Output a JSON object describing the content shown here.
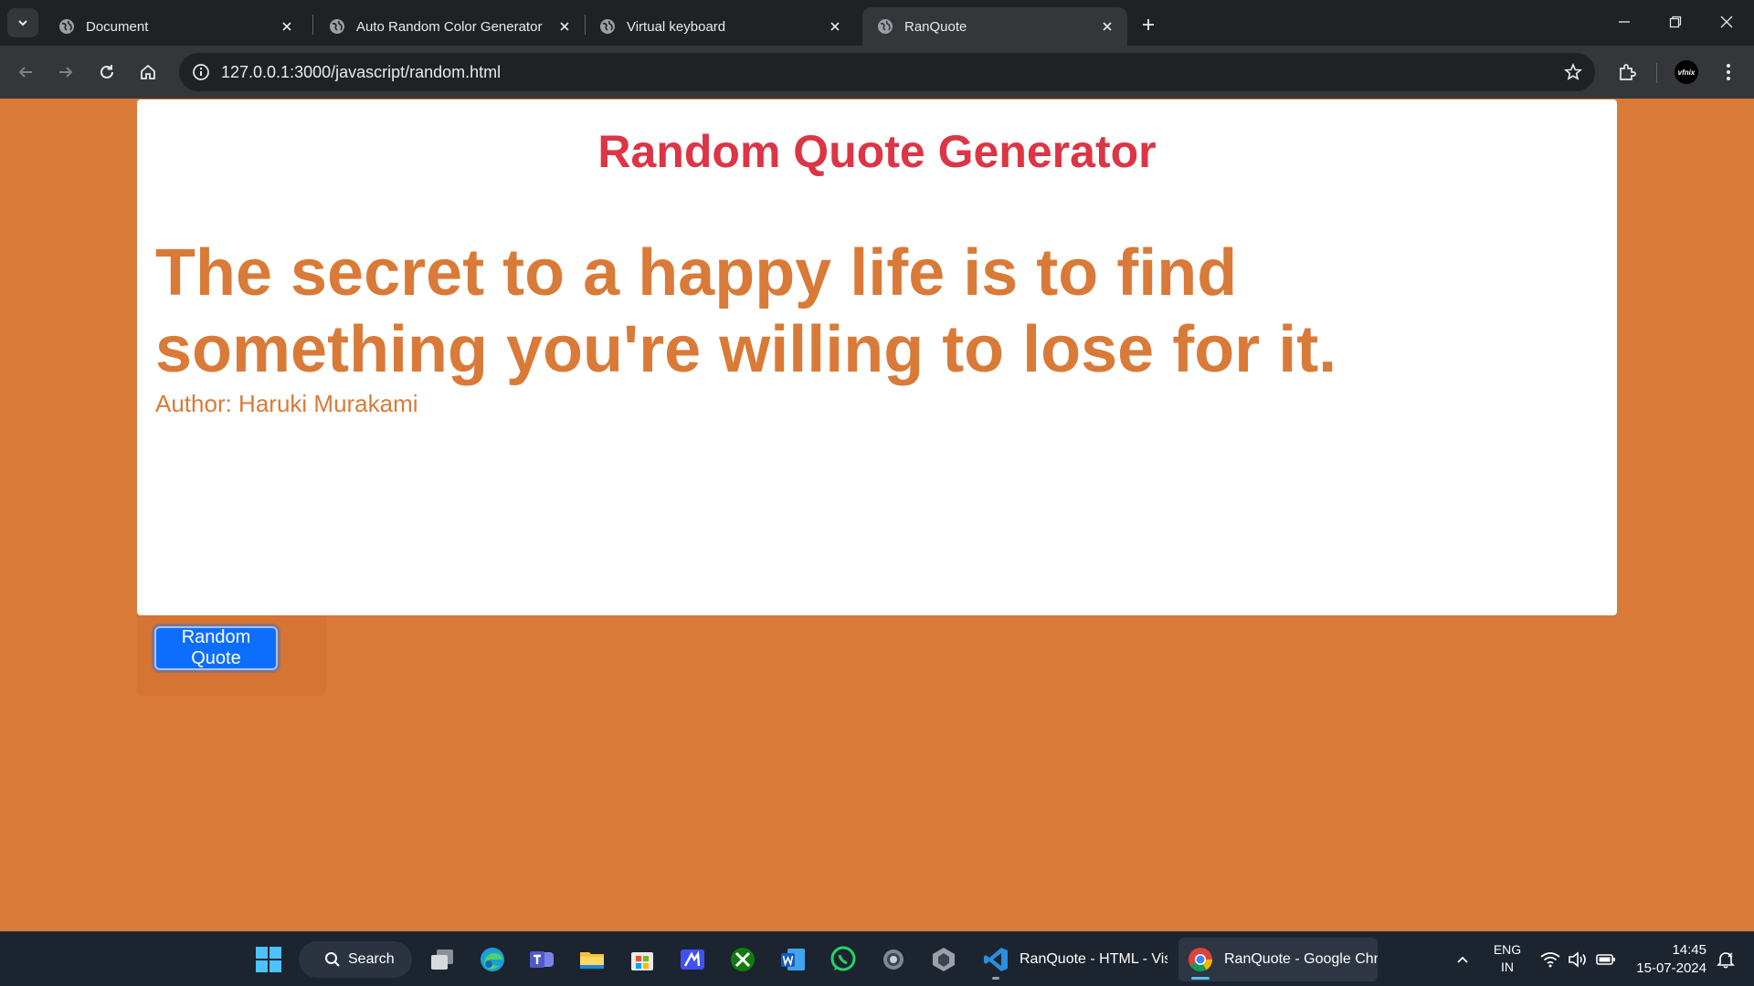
{
  "browser": {
    "tabs": [
      {
        "title": "Document",
        "active": false
      },
      {
        "title": "Auto Random Color Generator",
        "active": false
      },
      {
        "title": "Virtual keyboard",
        "active": false
      },
      {
        "title": "RanQuote",
        "active": true
      }
    ],
    "url": "127.0.0.1:3000/javascript/random.html",
    "profile_label": "vfnix"
  },
  "page": {
    "title": "Random Quote Generator",
    "quote": "The secret to a happy life is to find something you're willing to lose for it.",
    "author": "Author: Haruki Murakami",
    "button_label": "Random Quote"
  },
  "taskbar": {
    "search_label": "Search",
    "pinned_icons": [
      "task-view-icon",
      "edge-icon",
      "teams-icon",
      "file-explorer-icon",
      "store-icon",
      "pen-app-icon",
      "xbox-icon",
      "word-icon",
      "whatsapp-icon",
      "settings-icon",
      "unity-icon"
    ],
    "running_apps": [
      {
        "label": "RanQuote - HTML - Visual Studio Code",
        "icon": "vscode-icon",
        "active": false
      },
      {
        "label": "RanQuote - Google Chrome",
        "icon": "chrome-icon",
        "active": true
      }
    ],
    "language": {
      "line1": "ENG",
      "line2": "IN"
    },
    "time": "14:45",
    "date": "15-07-2024"
  },
  "colors": {
    "page_background": "#d97a38",
    "title_color": "#dc3545",
    "quote_color": "#d97a38",
    "button_color": "#0d6efd"
  }
}
